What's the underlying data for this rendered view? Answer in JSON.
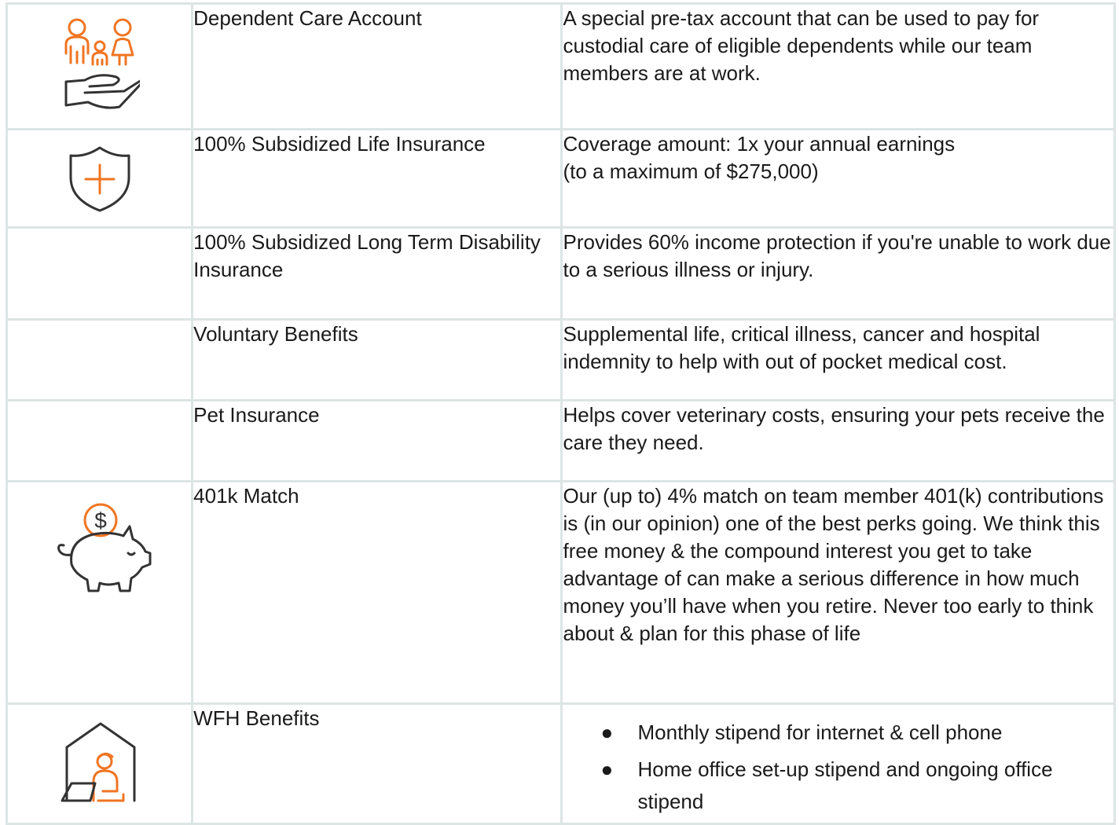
{
  "benefits": [
    {
      "icon": "family-care-icon",
      "name": "Dependent Care Account",
      "description": "A special pre-tax account that can be used to pay for custodial care of eligible dependents while our team members are at work."
    },
    {
      "icon": "shield-plus-icon",
      "name": "100% Subsidized Life Insurance",
      "description_lines": [
        "Coverage amount: 1x your annual earnings",
        "(to a maximum of $275,000)"
      ]
    },
    {
      "icon": "",
      "name": "100% Subsidized Long Term Disability Insurance",
      "description": "Provides 60% income protection if you're unable to work due to a serious illness or injury."
    },
    {
      "icon": "",
      "name": "Voluntary Benefits",
      "description": "Supplemental life, critical illness, cancer and hospital indemnity to help with out of pocket medical cost."
    },
    {
      "icon": "",
      "name": "Pet Insurance",
      "description": "Helps cover veterinary costs, ensuring your pets receive the care they need."
    },
    {
      "icon": "piggy-bank-icon",
      "name": "401k Match",
      "description": "Our (up to) 4% match on team member 401(k) contributions is (in our opinion) one of the best perks going. We think this free money & the compound interest you get to take advantage of can make a serious difference in how much money you’ll have when you retire. Never too early to think about & plan for this phase of life"
    },
    {
      "icon": "home-office-icon",
      "name": "WFH Benefits",
      "bullets": [
        "Monthly stipend for internet & cell phone",
        "Home office set-up stipend and ongoing office stipend"
      ]
    }
  ],
  "bullet_glyph": "●",
  "colors": {
    "accent": "#f07522",
    "icon_dark": "#333333",
    "border": "#dde4e4",
    "text": "#1a1a1a"
  }
}
